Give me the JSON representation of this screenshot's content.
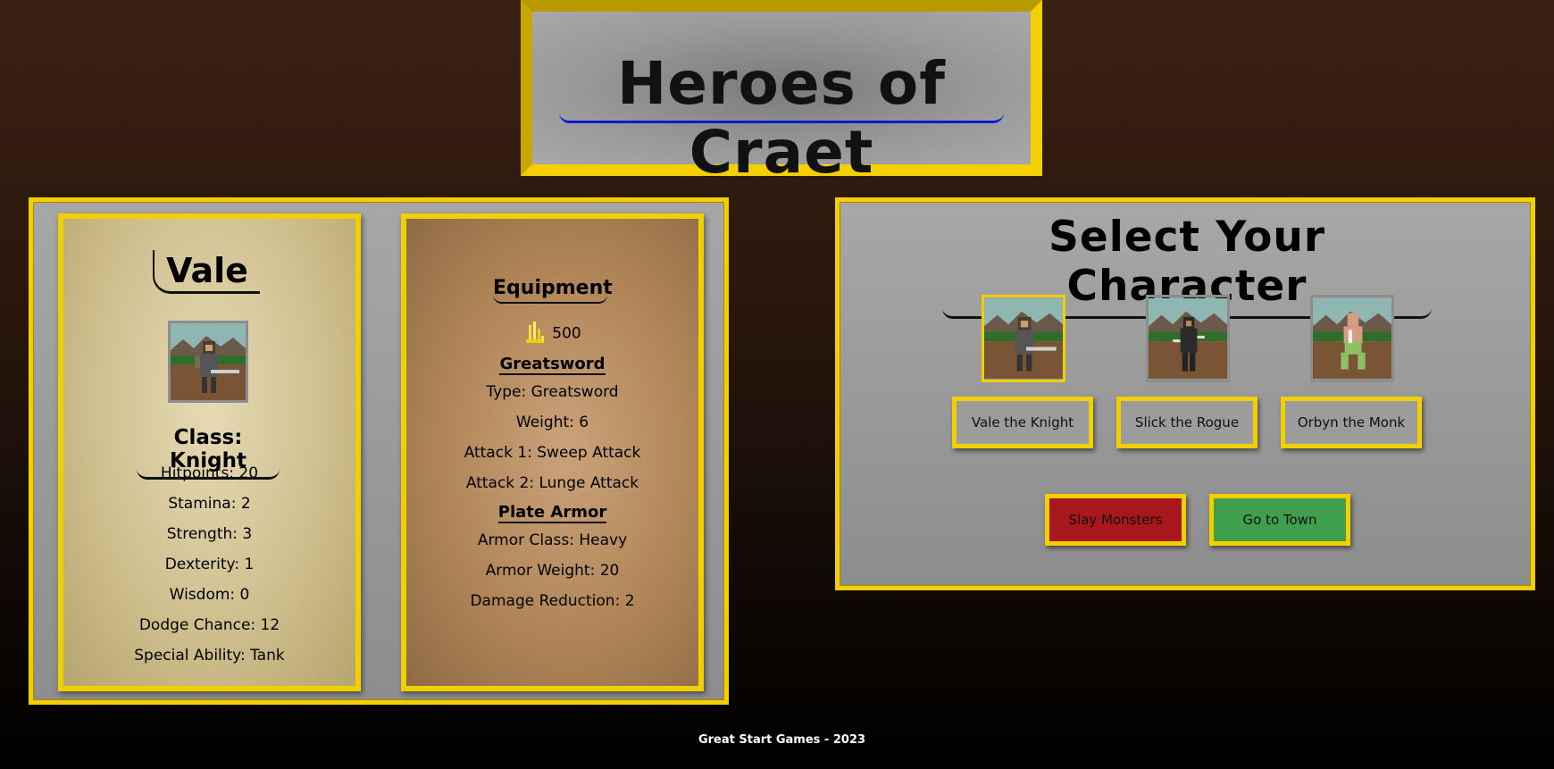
{
  "title": "Heroes of Craet",
  "character": {
    "name": "Vale",
    "class_label": "Class: Knight",
    "stats": [
      "Hitpoints: 20",
      "Stamina: 2",
      "Strength: 3",
      "Dexterity: 1",
      "Wisdom: 0",
      "Dodge Chance: 12",
      "Special Ability: Tank"
    ]
  },
  "equipment": {
    "heading": "Equipment",
    "gold": "500",
    "weapon": {
      "name": "Greatsword",
      "lines": [
        "Type: Greatsword",
        "Weight: 6",
        "Attack 1: Sweep Attack",
        "Attack 2: Lunge Attack"
      ]
    },
    "armor": {
      "name": "Plate Armor",
      "lines": [
        "Armor Class: Heavy",
        "Armor Weight: 20",
        "Damage Reduction: 2"
      ]
    }
  },
  "select": {
    "heading": "Select Your Character",
    "characters": [
      {
        "label": "Vale the Knight",
        "selected": true
      },
      {
        "label": "Slick the Rogue",
        "selected": false
      },
      {
        "label": "Orbyn the Monk",
        "selected": false
      }
    ],
    "actions": {
      "slay": "Slay Monsters",
      "town": "Go to Town"
    }
  },
  "footer": "Great Start Games - 2023",
  "colors": {
    "gold_frame": "#f2cf00",
    "slay_button": "#a8171b",
    "town_button": "#3f9f4f",
    "title_underline": "#0a1ad8"
  }
}
